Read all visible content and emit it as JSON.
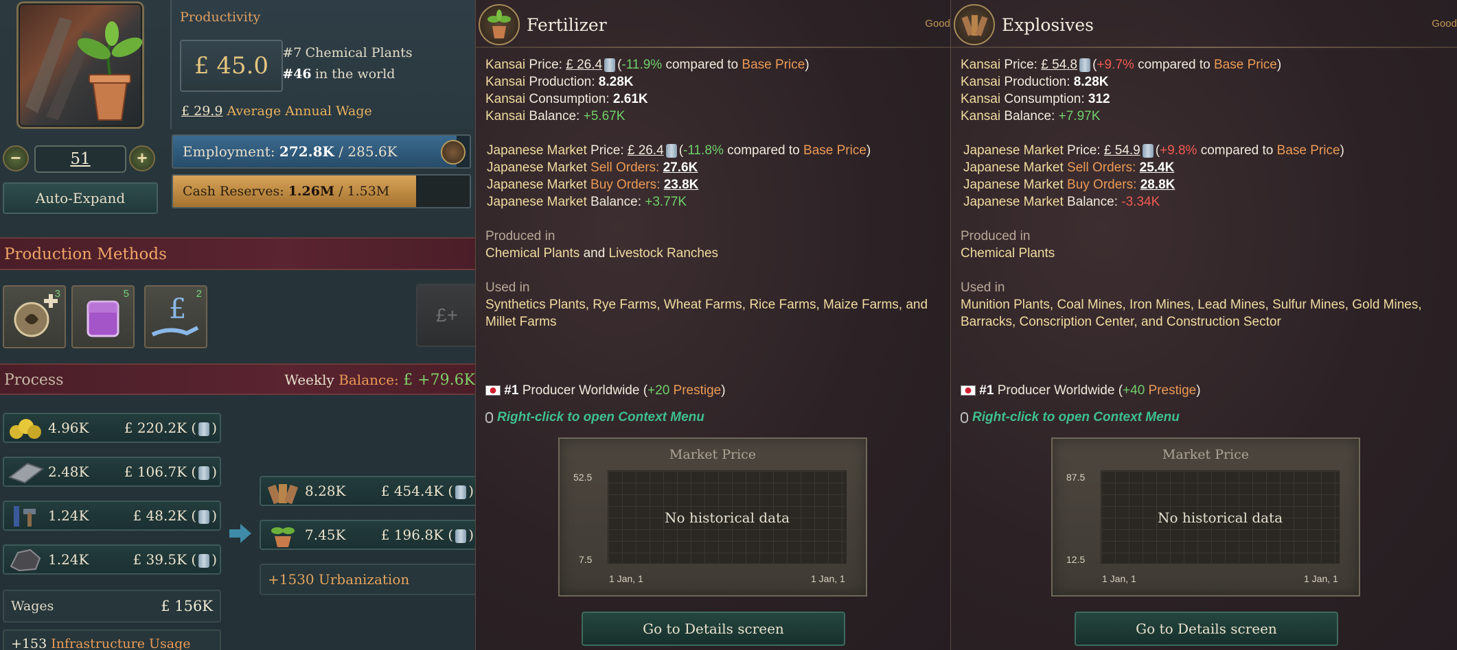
{
  "building": {
    "productivity_label": "Productivity",
    "productivity_value": "£ 45.0",
    "rank_building": "#7",
    "rank_building_text": "Chemical Plants",
    "rank_world": "#46",
    "rank_world_text": "in the world",
    "wage_value": "£ 29.9",
    "wage_label": "Average Annual Wage",
    "level": "51",
    "minus_label": "−",
    "plus_label": "+",
    "auto_expand_label": "Auto-Expand",
    "employment_label": "Employment:",
    "employment_current": "272.8K",
    "employment_max": "/ 285.6K",
    "employment_fill": 0.955,
    "cash_label": "Cash Reserves:",
    "cash_current": "1.26M",
    "cash_max": "/ 1.53M",
    "cash_fill": 0.82
  },
  "production_methods": {
    "header": "Production Methods",
    "methods": [
      {
        "icon": "fertilizer-plus-icon",
        "count": "3"
      },
      {
        "icon": "flask-icon",
        "count": "5"
      },
      {
        "icon": "pound-hand-icon",
        "count": "2"
      }
    ],
    "disabled_icon_label": "£+"
  },
  "process": {
    "header": "Process",
    "weekly_label": "Weekly",
    "balance_label": "Balance:",
    "balance_value": "£ +79.6K",
    "inputs": [
      {
        "icon": "sulfur-icon",
        "qty": "4.96K",
        "value": "£ 220.2K ("
      },
      {
        "icon": "iron-icon",
        "qty": "2.48K",
        "value": "£ 106.7K ("
      },
      {
        "icon": "tools-icon",
        "qty": "1.24K",
        "value": "£ 48.2K ("
      },
      {
        "icon": "coal-icon",
        "qty": "1.24K",
        "value": "£ 39.5K ("
      }
    ],
    "outputs": [
      {
        "icon": "explosives-icon",
        "qty": "8.28K",
        "value": "£ 454.4K ("
      },
      {
        "icon": "fertilizer-icon",
        "qty": "7.45K",
        "value": "£ 196.8K ("
      }
    ],
    "close_paren": ")",
    "urbanization": "+1530 Urbanization",
    "wages_label": "Wages",
    "wages_value": "£ 156K",
    "infra_value": "+153",
    "infra_label": "Infrastructure Usage"
  },
  "tooltips": [
    {
      "title": "Fertilizer",
      "tag": "Good",
      "local_price_label": "Kansai",
      "price_word": "Price:",
      "local_price": "£ 26.4",
      "local_change": "-11.9%",
      "compared": "compared to",
      "base_price": "Base Price",
      "prod_word": "Production:",
      "local_prod": "8.28K",
      "cons_word": "Consumption:",
      "local_cons": "2.61K",
      "bal_word": "Balance:",
      "local_bal": "+5.67K",
      "market_label": "Japanese Market",
      "market_price": "£ 26.4",
      "market_change": "-11.8%",
      "sell_word": "Sell Orders:",
      "sell_orders": "27.6K",
      "buy_word": "Buy Orders:",
      "buy_orders": "23.8K",
      "market_bal": "+3.77K",
      "produced_in_label": "Produced in",
      "produced_in_1": "Chemical Plants",
      "produced_in_and": "and",
      "produced_in_2": "Livestock Ranches",
      "used_in_label": "Used in",
      "used_in_line1": "Synthetics Plants, Rye Farms, Wheat Farms, Rice Farms, Maize Farms, and",
      "used_in_line2": "Millet Farms",
      "rank": "#1",
      "producer_text": "Producer Worldwide (",
      "prestige_value": "+20",
      "prestige_label": "Prestige",
      "close_paren": ")",
      "context_hint": "Right-click to open Context Menu",
      "chart_data": {
        "type": "line",
        "title": "Market Price",
        "ylim": [
          7.5,
          52.5
        ],
        "x_ticks": [
          "1 Jan, 1",
          "1 Jan, 1"
        ],
        "y_ticks": [
          "52.5",
          "7.5"
        ],
        "empty_message": "No historical data",
        "series": []
      },
      "details_button": "Go to Details screen"
    },
    {
      "title": "Explosives",
      "tag": "Good",
      "local_price_label": "Kansai",
      "price_word": "Price:",
      "local_price": "£ 54.8",
      "local_change": "+9.7%",
      "compared": "compared to",
      "base_price": "Base Price",
      "prod_word": "Production:",
      "local_prod": "8.28K",
      "cons_word": "Consumption:",
      "local_cons": "312",
      "bal_word": "Balance:",
      "local_bal": "+7.97K",
      "market_label": "Japanese Market",
      "market_price": "£ 54.9",
      "market_change": "+9.8%",
      "sell_word": "Sell Orders:",
      "sell_orders": "25.4K",
      "buy_word": "Buy Orders:",
      "buy_orders": "28.8K",
      "market_bal": "-3.34K",
      "produced_in_label": "Produced in",
      "produced_in_1": "Chemical Plants",
      "produced_in_and": "",
      "produced_in_2": "",
      "used_in_label": "Used in",
      "used_in_line1": "Munition Plants, Coal Mines, Iron Mines, Lead Mines, Sulfur Mines, Gold Mines,",
      "used_in_line2": "Barracks, Conscription Center, and Construction Sector",
      "rank": "#1",
      "producer_text": "Producer Worldwide (",
      "prestige_value": "+40",
      "prestige_label": "Prestige",
      "close_paren": ")",
      "context_hint": "Right-click to open Context Menu",
      "chart_data": {
        "type": "line",
        "title": "Market Price",
        "ylim": [
          12.5,
          87.5
        ],
        "x_ticks": [
          "1 Jan, 1",
          "1 Jan, 1"
        ],
        "y_ticks": [
          "87.5",
          "12.5"
        ],
        "empty_message": "No historical data",
        "series": []
      },
      "details_button": "Go to Details screen"
    }
  ]
}
